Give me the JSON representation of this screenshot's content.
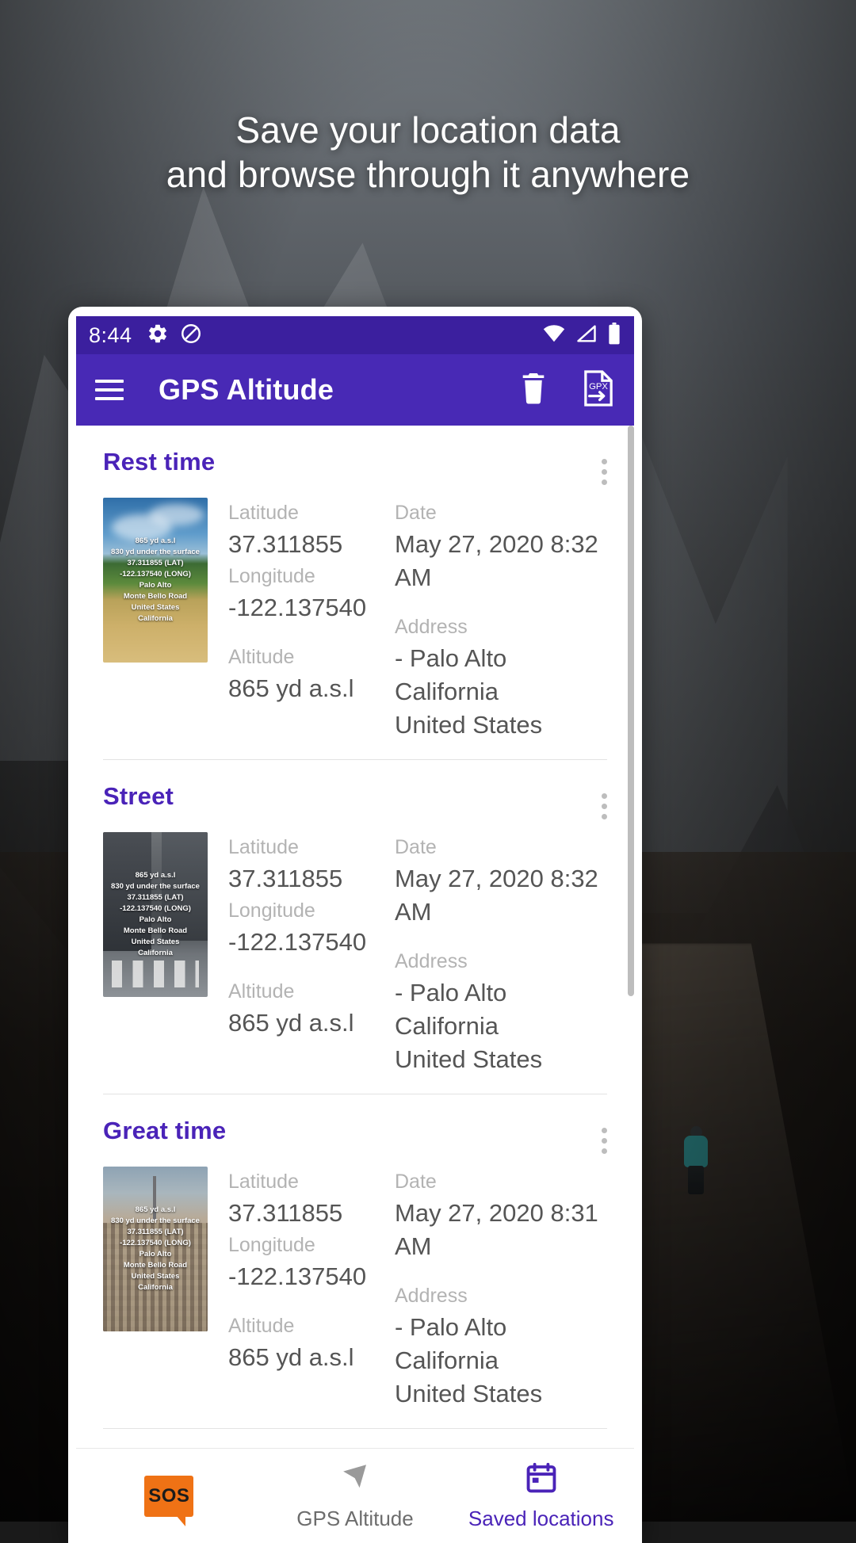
{
  "hero": {
    "headline_line1": "Save your location data",
    "headline_line2": "and browse through it anywhere"
  },
  "status_bar": {
    "time": "8:44",
    "icons": [
      "gear-icon",
      "do-not-disturb-icon",
      "wifi-icon",
      "signal-icon",
      "battery-icon"
    ]
  },
  "app_bar": {
    "title": "GPS Altitude",
    "menu_icon": "hamburger-menu-icon",
    "delete_icon": "trash-icon",
    "export_icon": "gpx-export-icon",
    "export_label": "GPX"
  },
  "labels": {
    "latitude": "Latitude",
    "longitude": "Longitude",
    "altitude": "Altitude",
    "date": "Date",
    "address": "Address"
  },
  "cards": [
    {
      "title": "Rest time",
      "latitude": "37.311855",
      "longitude": "-122.137540",
      "altitude": "865 yd a.s.l",
      "date": "May 27, 2020 8:32 AM",
      "address_line1": "- Palo Alto",
      "address_line2": "California",
      "address_line3": "United States",
      "thumb_style": "thumb-field",
      "thumb_overlay": [
        "865 yd a.s.l",
        "830 yd under the surface",
        "37.311855  (LAT)",
        "-122.137540  (LONG)",
        "Palo Alto",
        "Monte Bello Road",
        "United States",
        "California"
      ]
    },
    {
      "title": "Street",
      "latitude": "37.311855",
      "longitude": "-122.137540",
      "altitude": "865 yd a.s.l",
      "date": "May 27, 2020 8:32 AM",
      "address_line1": "- Palo Alto",
      "address_line2": "California",
      "address_line3": "United States",
      "thumb_style": "thumb-street",
      "thumb_overlay": [
        "865 yd a.s.l",
        "830 yd under the surface",
        "37.311855  (LAT)",
        "-122.137540  (LONG)",
        "Palo Alto",
        "Monte Bello Road",
        "United States",
        "California"
      ]
    },
    {
      "title": "Great time",
      "latitude": "37.311855",
      "longitude": "-122.137540",
      "altitude": "865 yd a.s.l",
      "date": "May 27, 2020 8:31 AM",
      "address_line1": "- Palo Alto",
      "address_line2": "California",
      "address_line3": "United States",
      "thumb_style": "thumb-city",
      "thumb_overlay": [
        "865 yd a.s.l",
        "830 yd under the surface",
        "37.311855  (LAT)",
        "-122.137540  (LONG)",
        "Palo Alto",
        "Monte Bello Road",
        "United States",
        "California"
      ]
    }
  ],
  "bottom_nav": [
    {
      "label": "",
      "icon": "sos-icon",
      "icon_text": "SOS",
      "active": false
    },
    {
      "label": "GPS Altitude",
      "icon": "navigation-arrow-icon",
      "active": false
    },
    {
      "label": "Saved locations",
      "icon": "calendar-icon",
      "active": true
    }
  ],
  "colors": {
    "status_bar": "#3b1f9e",
    "app_bar": "#4829b5",
    "accent": "#4a23b8",
    "sos_orange": "#ef7215",
    "label_gray": "#b3b3b3",
    "value_gray": "#555555"
  }
}
